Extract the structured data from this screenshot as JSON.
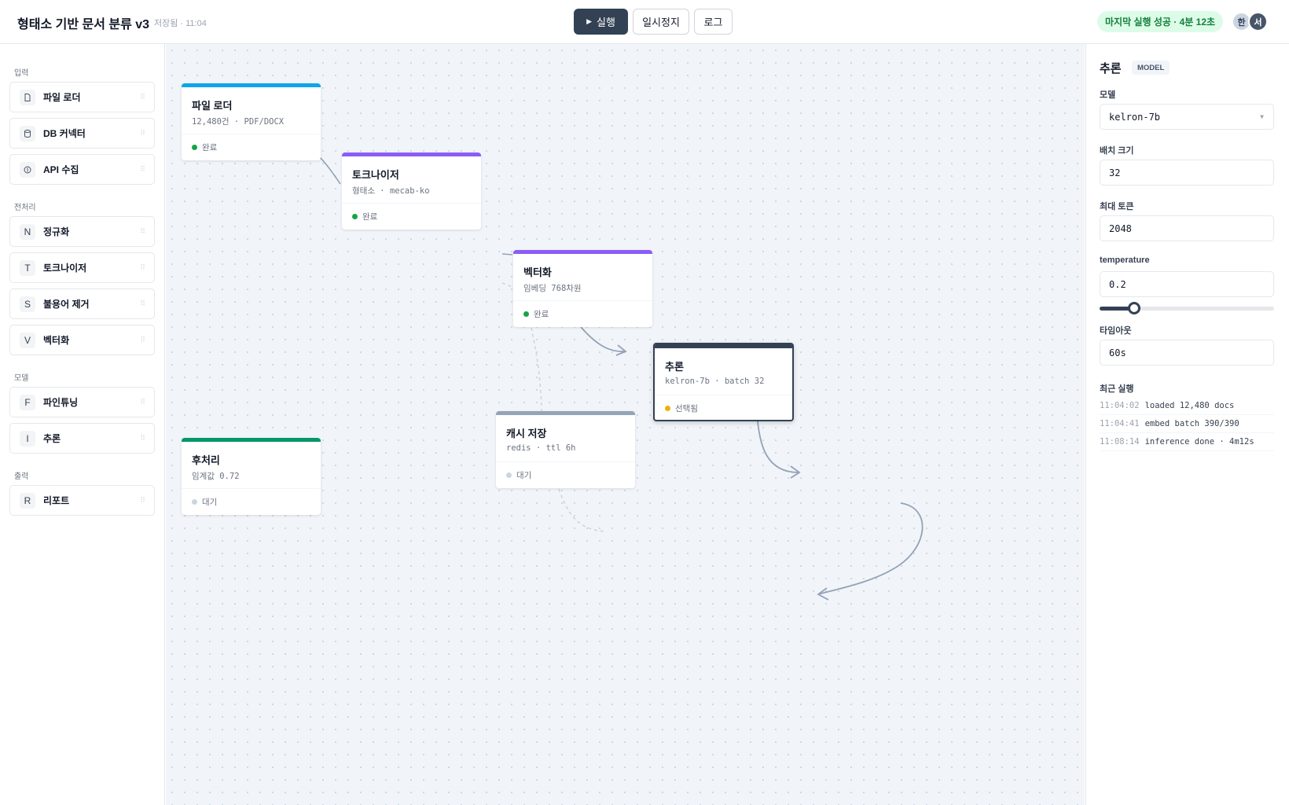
{
  "header": {
    "title": "형태소 기반 문서 분류 v3",
    "saved_status": "저장됨 · 11:04",
    "run_label": "실행",
    "pause_label": "일시정지",
    "log_label": "로그",
    "last_run_status": "마지막 실행 성공 · 4분 12초",
    "avatars": [
      "한",
      "서"
    ]
  },
  "sidebar": {
    "groups": [
      {
        "label": "입력",
        "items": [
          {
            "icon": "file-icon",
            "label": "파일 로더"
          },
          {
            "icon": "database-icon",
            "label": "DB 커넥터"
          },
          {
            "icon": "api-icon",
            "label": "API 수집"
          }
        ]
      },
      {
        "label": "전처리",
        "items": [
          {
            "icon": "N",
            "label": "정규화"
          },
          {
            "icon": "T",
            "label": "토크나이저"
          },
          {
            "icon": "S",
            "label": "불용어 제거"
          },
          {
            "icon": "V",
            "label": "벡터화"
          }
        ]
      },
      {
        "label": "모델",
        "items": [
          {
            "icon": "F",
            "label": "파인튜닝"
          },
          {
            "icon": "I",
            "label": "추론"
          }
        ]
      },
      {
        "label": "출력",
        "items": [
          {
            "icon": "R",
            "label": "리포트"
          }
        ]
      }
    ]
  },
  "nodes": [
    {
      "id": "loader",
      "title": "파일 로더",
      "subtitle": "12,480건 · PDF/DOCX",
      "status": "완료",
      "color": "#0ea5e9",
      "status_color": "#16a34a"
    },
    {
      "id": "tokenizer",
      "title": "토크나이저",
      "subtitle": "형태소 · mecab-ko",
      "status": "완료",
      "color": "#8b5cf6",
      "status_color": "#16a34a"
    },
    {
      "id": "vectorize",
      "title": "벡터화",
      "subtitle": "임베딩 768차원",
      "status": "완료",
      "color": "#8b5cf6",
      "status_color": "#16a34a"
    },
    {
      "id": "inference",
      "title": "추론",
      "subtitle": "kelron-7b · batch 32",
      "status": "선택됨",
      "color": "#334155",
      "status_color": "#eab308"
    },
    {
      "id": "cache",
      "title": "캐시 저장",
      "subtitle": "redis · ttl 6h",
      "status": "대기",
      "color": "#94a3b8",
      "status_color": "#cbd5e1"
    },
    {
      "id": "postprocess",
      "title": "후처리",
      "subtitle": "임계값 0.72",
      "status": "대기",
      "color": "#059669",
      "status_color": "#cbd5e1"
    }
  ],
  "inspector": {
    "title": "추론",
    "badge": "MODEL",
    "model_label": "모델",
    "model_value": "kelron-7b",
    "batch_label": "배치 크기",
    "batch_value": "32",
    "max_tokens_label": "최대 토큰",
    "max_tokens_value": "2048",
    "temperature_label": "temperature",
    "temperature_value": "0.2",
    "temperature_slider_fraction": 0.2,
    "timeout_label": "타임아웃",
    "timeout_value": "60s",
    "recent_label": "최근 실행",
    "recent_runs": [
      {
        "time": "11:04:02",
        "text": "loaded 12,480 docs"
      },
      {
        "time": "11:04:41",
        "text": "embed batch 390/390"
      },
      {
        "time": "11:08:14",
        "text": "inference done · 4m12s"
      }
    ]
  }
}
